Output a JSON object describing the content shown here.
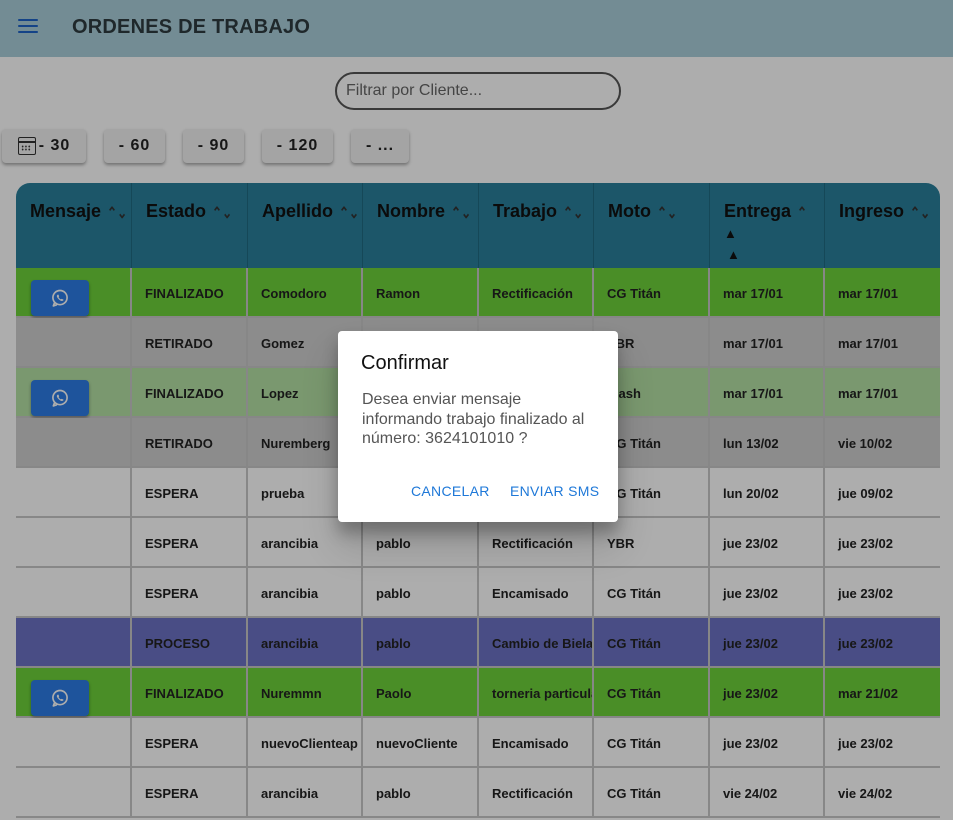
{
  "header": {
    "title": "ORDENES DE TRABAJO",
    "menu_icon": "menu-icon"
  },
  "filter": {
    "placeholder": "Filtrar por Cliente...",
    "value": ""
  },
  "day_buttons": [
    {
      "label": "- 30",
      "icon": "calendar-icon"
    },
    {
      "label": "- 60"
    },
    {
      "label": "- 90"
    },
    {
      "label": "- 120"
    },
    {
      "label": "- ..."
    }
  ],
  "table": {
    "columns": [
      "Mensaje",
      "Estado",
      "Apellido",
      "Nombre",
      "Trabajo",
      "Moto",
      "Entrega",
      "Ingreso"
    ],
    "rows": [
      {
        "whatsapp": true,
        "estado": "FINALIZADO",
        "apellido": "Comodoro",
        "nombre": "Ramon",
        "trabajo": "Rectificación",
        "moto": "CG Titán",
        "entrega": "mar 17/01",
        "ingreso": "mar 17/01",
        "bg": "#6dd23a"
      },
      {
        "whatsapp": false,
        "estado": "RETIRADO",
        "apellido": "Gomez",
        "nombre": "",
        "trabajo": "",
        "moto": "YBR",
        "entrega": "mar 17/01",
        "ingreso": "mar 17/01",
        "bg": "#cfcfcf"
      },
      {
        "whatsapp": true,
        "estado": "FINALIZADO",
        "apellido": "Lopez",
        "nombre": "",
        "trabajo": "",
        "moto": "mash",
        "entrega": "mar 17/01",
        "ingreso": "mar 17/01",
        "bg": "#b4e0a4"
      },
      {
        "whatsapp": false,
        "estado": "RETIRADO",
        "apellido": "Nuremberg",
        "nombre": "",
        "trabajo": "",
        "moto": "CG Titán",
        "entrega": "lun 13/02",
        "ingreso": "vie 10/02",
        "bg": "#cfcfcf"
      },
      {
        "whatsapp": false,
        "estado": "ESPERA",
        "apellido": "prueba",
        "nombre": "",
        "trabajo": "",
        "moto": "CG Titán",
        "entrega": "lun 20/02",
        "ingreso": "jue 09/02",
        "bg": "#ffffff"
      },
      {
        "whatsapp": false,
        "estado": "ESPERA",
        "apellido": "arancibia",
        "nombre": "pablo",
        "trabajo": "Rectificación",
        "moto": "YBR",
        "entrega": "jue 23/02",
        "ingreso": "jue 23/02",
        "bg": "#ffffff"
      },
      {
        "whatsapp": false,
        "estado": "ESPERA",
        "apellido": "arancibia",
        "nombre": "pablo",
        "trabajo": "Encamisado",
        "moto": "CG Titán",
        "entrega": "jue 23/02",
        "ingreso": "jue 23/02",
        "bg": "#ffffff"
      },
      {
        "whatsapp": false,
        "estado": "PROCESO",
        "apellido": "arancibia",
        "nombre": "pablo",
        "trabajo": "Cambio de Biela",
        "moto": "CG Titán",
        "entrega": "jue 23/02",
        "ingreso": "jue 23/02",
        "bg": "#6c72c4"
      },
      {
        "whatsapp": true,
        "estado": "FINALIZADO",
        "apellido": "Nuremmn",
        "nombre": "Paolo",
        "trabajo": "torneria particular",
        "moto": "CG Titán",
        "entrega": "jue 23/02",
        "ingreso": "mar 21/02",
        "bg": "#6dd23a"
      },
      {
        "whatsapp": false,
        "estado": "ESPERA",
        "apellido": "nuevoClienteap",
        "nombre": "nuevoCliente",
        "trabajo": "Encamisado",
        "moto": "CG Titán",
        "entrega": "jue 23/02",
        "ingreso": "jue 23/02",
        "bg": "#ffffff"
      },
      {
        "whatsapp": false,
        "estado": "ESPERA",
        "apellido": "arancibia",
        "nombre": "pablo",
        "trabajo": "Rectificación",
        "moto": "CG Titán",
        "entrega": "vie 24/02",
        "ingreso": "vie 24/02",
        "bg": "#ffffff"
      }
    ]
  },
  "dialog": {
    "title": "Confirmar",
    "message": "Desea enviar mensaje informando trabajo finalizado al número: 3624101010 ?",
    "cancel_label": "CANCELAR",
    "confirm_label": "ENVIAR SMS"
  },
  "colors": {
    "appbar": "#aacfdb",
    "table_header": "#2a7f9b",
    "finalizado": "#6dd23a",
    "retirado": "#cfcfcf",
    "proceso": "#6c72c4",
    "whatsapp_button": "#2d7de6",
    "dialog_button": "#1e78d8"
  }
}
